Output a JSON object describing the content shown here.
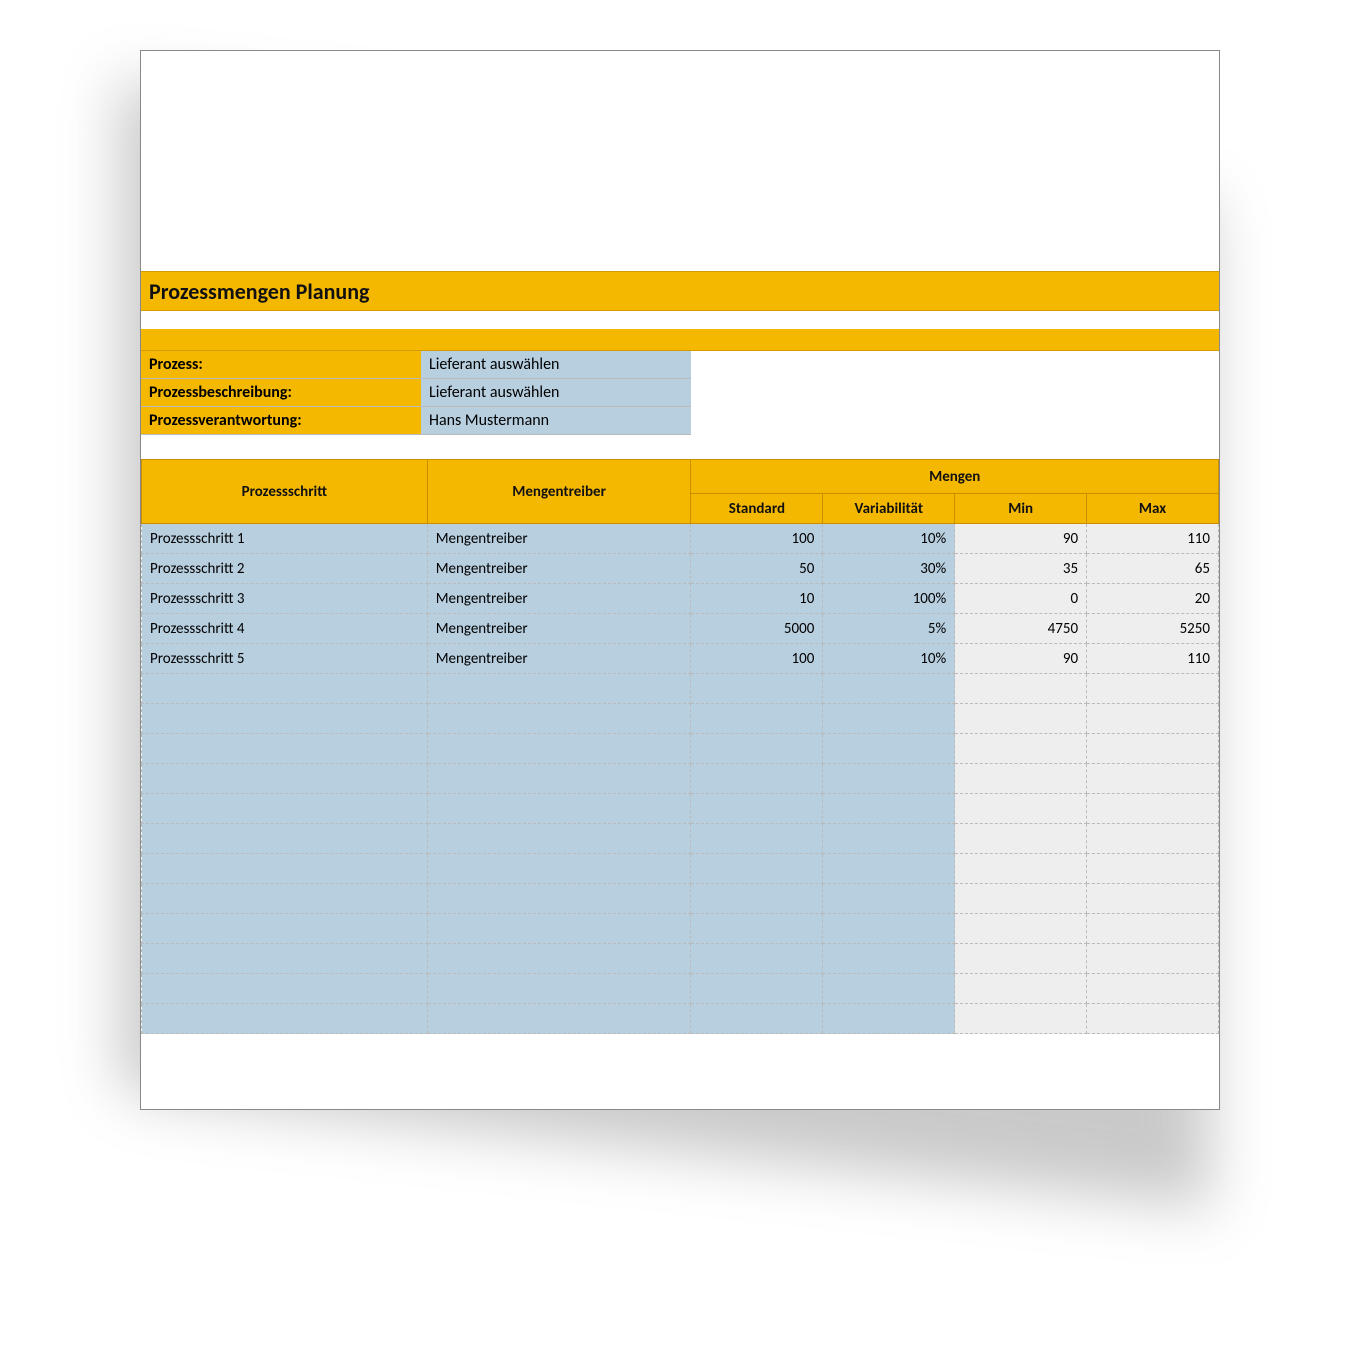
{
  "title": "Prozessmengen Planung",
  "meta": {
    "prozess_label": "Prozess:",
    "prozess_value": "Lieferant auswählen",
    "beschreibung_label": "Prozessbeschreibung:",
    "beschreibung_value": "Lieferant auswählen",
    "verantwortung_label": "Prozessverantwortung:",
    "verantwortung_value": "Hans Mustermann"
  },
  "headers": {
    "step": "Prozessschritt",
    "driver": "Mengentreiber",
    "mengen": "Mengen",
    "standard": "Standard",
    "variabilitaet": "Variabilität",
    "min": "Min",
    "max": "Max"
  },
  "rows": [
    {
      "step": "Prozessschritt 1",
      "driver": "Mengentreiber",
      "standard": "100",
      "variability": "10%",
      "min": "90",
      "max": "110"
    },
    {
      "step": "Prozessschritt 2",
      "driver": "Mengentreiber",
      "standard": "50",
      "variability": "30%",
      "min": "35",
      "max": "65"
    },
    {
      "step": "Prozessschritt 3",
      "driver": "Mengentreiber",
      "standard": "10",
      "variability": "100%",
      "min": "0",
      "max": "20"
    },
    {
      "step": "Prozessschritt 4",
      "driver": "Mengentreiber",
      "standard": "5000",
      "variability": "5%",
      "min": "4750",
      "max": "5250"
    },
    {
      "step": "Prozessschritt 5",
      "driver": "Mengentreiber",
      "standard": "100",
      "variability": "10%",
      "min": "90",
      "max": "110"
    }
  ],
  "empty_rows": 12,
  "chart_data": {
    "type": "table",
    "title": "Prozessmengen Planung",
    "columns": [
      "Prozessschritt",
      "Mengentreiber",
      "Standard",
      "Variabilität",
      "Min",
      "Max"
    ],
    "data": [
      [
        "Prozessschritt 1",
        "Mengentreiber",
        100,
        0.1,
        90,
        110
      ],
      [
        "Prozessschritt 2",
        "Mengentreiber",
        50,
        0.3,
        35,
        65
      ],
      [
        "Prozessschritt 3",
        "Mengentreiber",
        10,
        1.0,
        0,
        20
      ],
      [
        "Prozessschritt 4",
        "Mengentreiber",
        5000,
        0.05,
        4750,
        5250
      ],
      [
        "Prozessschritt 5",
        "Mengentreiber",
        100,
        0.1,
        90,
        110
      ]
    ]
  }
}
